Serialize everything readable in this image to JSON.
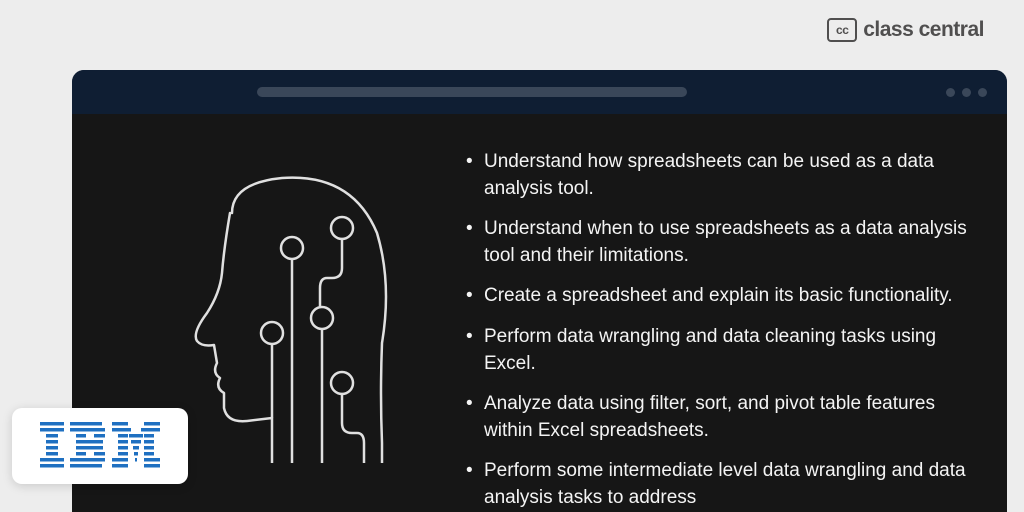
{
  "header": {
    "badge_text": "cc",
    "brand_text": "class central"
  },
  "bullets": [
    "Understand how spreadsheets can be used as a data analysis tool.",
    "Understand when to use spreadsheets as a data analysis tool and their limitations.",
    "Create a spreadsheet and explain its basic functionality.",
    "Perform data wrangling and data cleaning tasks using Excel.",
    "Analyze data using filter, sort, and pivot table features within Excel spreadsheets.",
    "Perform some intermediate level data wrangling and data analysis tasks to address"
  ],
  "provider": {
    "name": "IBM"
  }
}
